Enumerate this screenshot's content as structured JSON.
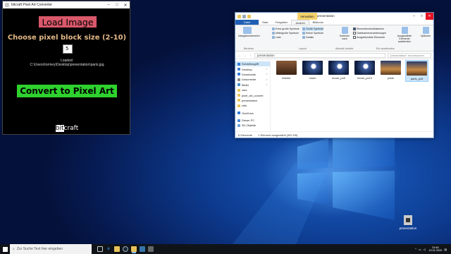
{
  "pixel_converter": {
    "window_title": "bitcraft Pixel Art Converter",
    "load_label": "Load Image",
    "block_size_label": "Choose pixel block size (2-10)",
    "block_size_value": "5",
    "loaded_label": "Loaded:",
    "loaded_path": "C:\\Users\\tormey\\Desktop\\presentation\\paris.jpg",
    "convert_label": "Convert to Pixel Art",
    "brand_prefix": "bit",
    "brand_suffix": "craft"
  },
  "explorer": {
    "context_tab": "Verwalten",
    "title": "presentation",
    "tabs": [
      "Datei",
      "Start",
      "Freigeben",
      "Ansicht",
      "Bildtools"
    ],
    "ribbon": {
      "nav_pane": "Navigationsbereich",
      "layout_items": [
        "Extra große Symbole",
        "Große Symbole",
        "Mittelgroße Symbole",
        "Kleine Symbole",
        "Liste",
        "Details"
      ],
      "sort_label": "Sortieren nach",
      "checkboxes": [
        "Elementkontrollkästchen",
        "Dateinamenerweiterungen",
        "Ausgeblendete Elemente"
      ],
      "hide_label": "Ausgewählte Elemente ausblenden",
      "options_label": "Optionen",
      "groups": [
        "Bereiche",
        "Layout",
        "Aktuelle Ansicht",
        "Ein-/ausblenden"
      ]
    },
    "address": "presentation",
    "search_placeholder": "\"presentation\" durchsuchen",
    "nav_items": [
      {
        "label": "Schnellzugriff",
        "color": "#2f78d8",
        "pinned": false
      },
      {
        "label": "Desktop",
        "color": "#3b7fd4",
        "pinned": true
      },
      {
        "label": "Downloads",
        "color": "#2f78d8",
        "pinned": true
      },
      {
        "label": "Dokumente",
        "color": "#8a8a8a",
        "pinned": true
      },
      {
        "label": "Bilder",
        "color": "#3b8fd8",
        "pinned": true
      },
      {
        "label": "cars",
        "color": "#e8c35a",
        "pinned": false
      },
      {
        "label": "pixel_art_convert",
        "color": "#e8c35a",
        "pinned": false
      },
      {
        "label": "presentation",
        "color": "#e8c35a",
        "pinned": false
      },
      {
        "label": "vids",
        "color": "#e8c35a",
        "pinned": false
      },
      {
        "label": "OneDrive",
        "color": "#2f78d8",
        "pinned": false
      },
      {
        "label": "Dieser PC",
        "color": "#4a89d8",
        "pinned": false
      },
      {
        "label": "3D-Objekte",
        "color": "#6aa0e0",
        "pinned": false
      }
    ],
    "files": [
      {
        "name": "interior",
        "bg": "linear-gradient(180deg,#8a5a3a,#3a2214)"
      },
      {
        "name": "moon",
        "bg": "radial-gradient(circle at 55% 40%,#ffffff 0 14%,#3a5a9a 22%,#0e1c3e 70%)"
      },
      {
        "name": "moon_px5",
        "bg": "radial-gradient(circle at 55% 40%,#ffffff 0 14%,#3a5a9a 22%,#0e1c3e 70%)"
      },
      {
        "name": "moon_px10",
        "bg": "radial-gradient(circle at 55% 40%,#ffffff 0 14%,#3a5a9a 22%,#0e1c3e 70%)"
      },
      {
        "name": "paris",
        "bg": "linear-gradient(180deg,#2a3c6a,#c98a44 60%,#5a3a22)"
      },
      {
        "name": "paris_px5",
        "bg": "linear-gradient(180deg,#2a3c6a,#c98a44 60%,#5a3a22)"
      }
    ],
    "status_count": "6 Elemente",
    "status_selected": "1 Element ausgewählt (352 KB)"
  },
  "desktop_icon": {
    "label": "presentation"
  },
  "taskbar": {
    "search_placeholder": "Zur Suche Text hier eingeben",
    "time": "23:46",
    "date": "19.01.2020"
  }
}
